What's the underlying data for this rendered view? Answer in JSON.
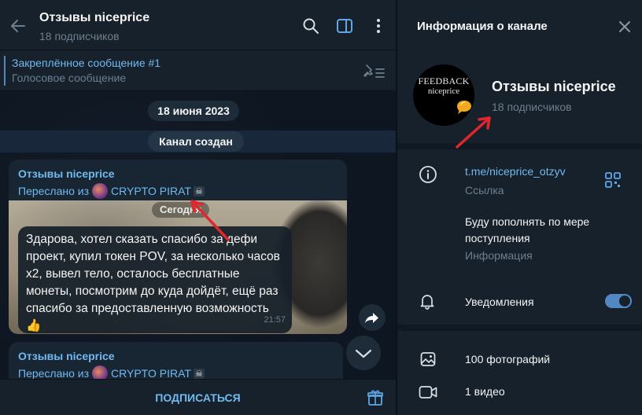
{
  "colors": {
    "accent": "#5288c1",
    "link": "#71baf0",
    "muted": "#6d7f8f",
    "annotation_arrow": "#e0272b"
  },
  "chat": {
    "header": {
      "title": "Отзывы niceprice",
      "subtitle": "18 подписчиков",
      "icons": [
        "back-arrow-icon",
        "search-icon",
        "sidebar-toggle-icon",
        "more-vertical-icon"
      ]
    },
    "pinned": {
      "title": "Закреплённое сообщение #1",
      "text": "Голосовое сообщение",
      "icon": "pinned-list-icon"
    },
    "date_pill": "18 июня 2023",
    "service_message": "Канал создан",
    "message1": {
      "author": "Отзывы niceprice",
      "forward_prefix": "Переслано из",
      "forward_name": "CRYPTO PIRAT",
      "forward_badge": "☠",
      "photo_date": "Сегодня",
      "text": "Здарова, хотел сказать спасибо за дефи проект, купил токен POV, за несколько часов х2, вывел тело, осталось бесплатные монеты, посмотрим до куда дойдёт, ещё раз спасибо за предоставленную возможность👍",
      "time": "21:57"
    },
    "message2": {
      "author": "Отзывы niceprice",
      "forward_prefix": "Переслано из",
      "forward_name": "CRYPTO PIRAT",
      "forward_badge": "☠"
    },
    "bottom": {
      "subscribe_label": "ПОДПИСАТЬСЯ",
      "icon": "gift-icon"
    }
  },
  "info": {
    "title": "Информация о канале",
    "channel_name": "Отзывы niceprice",
    "subscribers": "18 подписчиков",
    "avatar_text": [
      "FEEDBACK",
      "niceprice"
    ],
    "link": "t.me/niceprice_otzyv",
    "link_caption": "Ссылка",
    "description": "Буду пополнять по мере поступления",
    "description_caption": "Информация",
    "notifications_label": "Уведомления",
    "notifications_on": true,
    "photos_label": "100 фотографий",
    "videos_label": "1 видео"
  }
}
